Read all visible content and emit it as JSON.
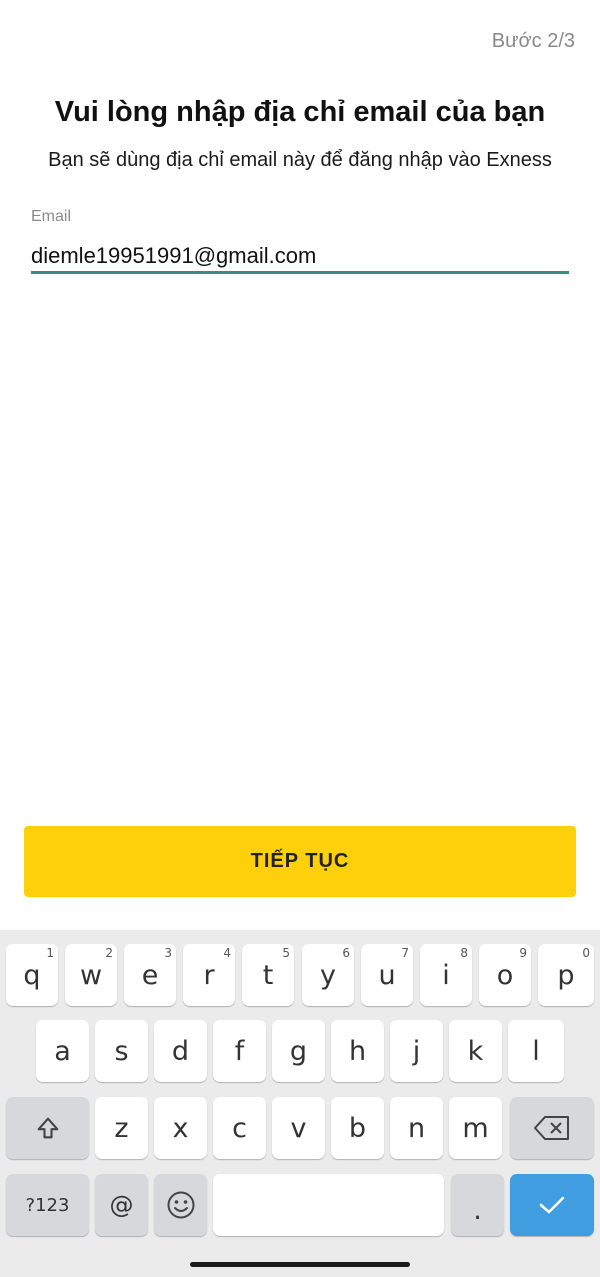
{
  "header": {
    "step": "Bước 2/3"
  },
  "main": {
    "title": "Vui lòng nhập địa chỉ email của bạn",
    "subtitle": "Bạn sẽ dùng địa chỉ email này để đăng nhập vào Exness",
    "email_label": "Email",
    "email_value": "diemle19951991@gmail.com",
    "continue_label": "TIẾP TỤC"
  },
  "colors": {
    "accent_underline": "#3f8a84",
    "button_yellow": "#fed00b",
    "keyboard_bg": "#ebebeb",
    "done_key": "#3f9de0"
  },
  "keyboard": {
    "row1": [
      {
        "k": "q",
        "h": "1"
      },
      {
        "k": "w",
        "h": "2"
      },
      {
        "k": "e",
        "h": "3"
      },
      {
        "k": "r",
        "h": "4"
      },
      {
        "k": "t",
        "h": "5"
      },
      {
        "k": "y",
        "h": "6"
      },
      {
        "k": "u",
        "h": "7"
      },
      {
        "k": "i",
        "h": "8"
      },
      {
        "k": "o",
        "h": "9"
      },
      {
        "k": "p",
        "h": "0"
      }
    ],
    "row2": [
      "a",
      "s",
      "d",
      "f",
      "g",
      "h",
      "j",
      "k",
      "l"
    ],
    "row3": [
      "z",
      "x",
      "c",
      "v",
      "b",
      "n",
      "m"
    ],
    "shift_icon": "shift-arrow-icon",
    "backspace_icon": "backspace-icon",
    "symbols_label": "?123",
    "at_label": "@",
    "emoji_icon": "emoji-icon",
    "period_label": ".",
    "done_icon": "checkmark-icon"
  }
}
